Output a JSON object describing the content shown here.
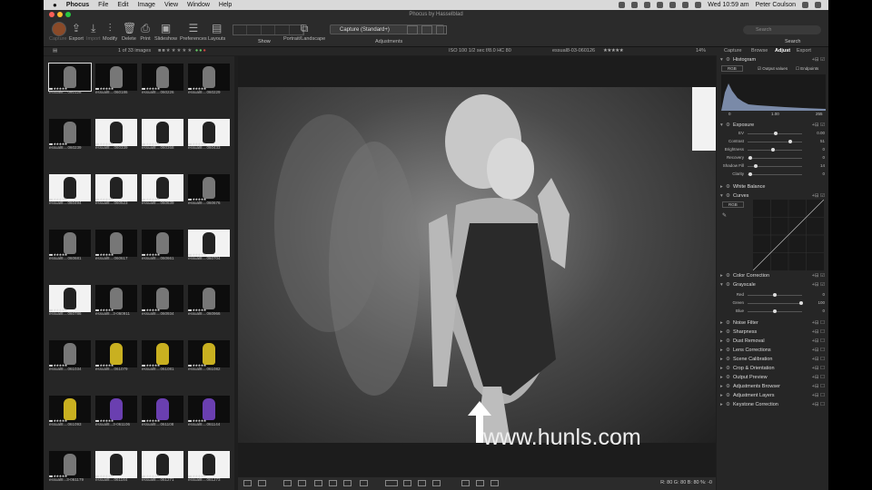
{
  "menubar": {
    "apple": "",
    "app": "Phocus",
    "items": [
      "File",
      "Edit",
      "Image",
      "View",
      "Window",
      "Help"
    ],
    "clock": "Wed 10:59 am",
    "user": "Peter Coulson"
  },
  "window": {
    "title": "Phocus by Hasselblad"
  },
  "toolbar": {
    "buttons": [
      "Capture",
      "Export",
      "Import",
      "Modify",
      "Delete",
      "Print",
      "Slideshow",
      "Preferences",
      "Layouts"
    ],
    "show_label": "Show",
    "orientation_label": "Portrait/Landscape",
    "preset": "Capture (Standard+)",
    "adjustments_label": "Adjustments",
    "search_placeholder": "Search",
    "search_label": "Search"
  },
  "subbar": {
    "count": "1 of 33 images",
    "exif": "ISO 100  1/2 sec  f/8.0  HC 80",
    "filename": "essual8-03-060126",
    "zoom": "14%"
  },
  "panel_tabs": [
    "Capture",
    "Browse",
    "Adjust",
    "Export"
  ],
  "histogram": {
    "title": "Histogram",
    "channel": "RGB",
    "output_values": "Output values",
    "endpoints": "Endpoints",
    "ticks": [
      "0",
      "1.00",
      "255"
    ]
  },
  "exposure": {
    "title": "Exposure",
    "sliders": [
      {
        "label": "EV",
        "value": "0.00",
        "pos": 0.5
      },
      {
        "label": "Contrast",
        "value": "51",
        "pos": 0.78
      },
      {
        "label": "Brightness",
        "value": "0",
        "pos": 0.45
      },
      {
        "label": "Recovery",
        "value": "0",
        "pos": 0.02
      },
      {
        "label": "Shadow Fill",
        "value": "14",
        "pos": 0.12
      },
      {
        "label": "Clarity",
        "value": "0",
        "pos": 0.02
      }
    ]
  },
  "white_balance": {
    "title": "White Balance"
  },
  "curves": {
    "title": "Curves",
    "channel": "RGB"
  },
  "color_correction": {
    "title": "Color Correction"
  },
  "grayscale": {
    "title": "Grayscale",
    "sliders": [
      {
        "label": "Red",
        "value": "0",
        "pos": 0.48
      },
      {
        "label": "Green",
        "value": "100",
        "pos": 0.98
      },
      {
        "label": "Blue",
        "value": "0",
        "pos": 0.48
      }
    ]
  },
  "sections": [
    "Noise Filter",
    "Sharpness",
    "Dust Removal",
    "Lens Corrections",
    "Scene Calibration",
    "Crop & Orientation",
    "Output Preview",
    "Adjustments Browser",
    "Adjustment Layers",
    "Keystone Correction"
  ],
  "thumbnails": [
    {
      "caption": "essual8....060128",
      "style": "dark",
      "selected": true
    },
    {
      "caption": "essual8....060186",
      "style": "dark"
    },
    {
      "caption": "essual8....060226",
      "style": "dark"
    },
    {
      "caption": "essual8....060229",
      "style": "dark"
    },
    {
      "caption": "essual8....060239",
      "style": "dark"
    },
    {
      "caption": "essual8....060339",
      "style": "white"
    },
    {
      "caption": "essual8....060368",
      "style": "white"
    },
    {
      "caption": "essual8....060433",
      "style": "white"
    },
    {
      "caption": "essual8....060494",
      "style": "white"
    },
    {
      "caption": "essual8....060523",
      "style": "white"
    },
    {
      "caption": "essual8....060639",
      "style": "white"
    },
    {
      "caption": "essual8....060676",
      "style": "dark"
    },
    {
      "caption": "essual8....060681",
      "style": "dark"
    },
    {
      "caption": "essual8....060617",
      "style": "dark"
    },
    {
      "caption": "essual8....060661",
      "style": "dark"
    },
    {
      "caption": "essual8....060704",
      "style": "white"
    },
    {
      "caption": "essual8....060786",
      "style": "white"
    },
    {
      "caption": "essual8...3-060911",
      "style": "dark"
    },
    {
      "caption": "essual8....060934",
      "style": "dark"
    },
    {
      "caption": "essual8....060966",
      "style": "dark"
    },
    {
      "caption": "essual8....061034",
      "style": "dark"
    },
    {
      "caption": "essual8....061079",
      "style": "yellow"
    },
    {
      "caption": "essual8....061081",
      "style": "yellow"
    },
    {
      "caption": "essual8....061082",
      "style": "yellow"
    },
    {
      "caption": "essual8....061093",
      "style": "yellow"
    },
    {
      "caption": "essual8...3-061106",
      "style": "purple"
    },
    {
      "caption": "essual8....061108",
      "style": "purple"
    },
    {
      "caption": "essual8....061144",
      "style": "purple"
    },
    {
      "caption": "essual8...3-061179",
      "style": "dark"
    },
    {
      "caption": "essual8....061184",
      "style": "white"
    },
    {
      "caption": "essual8....061271",
      "style": "white"
    },
    {
      "caption": "essual8....061273",
      "style": "white"
    }
  ],
  "readout": "R: 80  G: 80  B: 80  %: -0",
  "watermark": "www.hunls.com",
  "colors": {
    "menubar": "#d9d9d9",
    "panel": "#262626",
    "accent": "#3b7bd8"
  }
}
